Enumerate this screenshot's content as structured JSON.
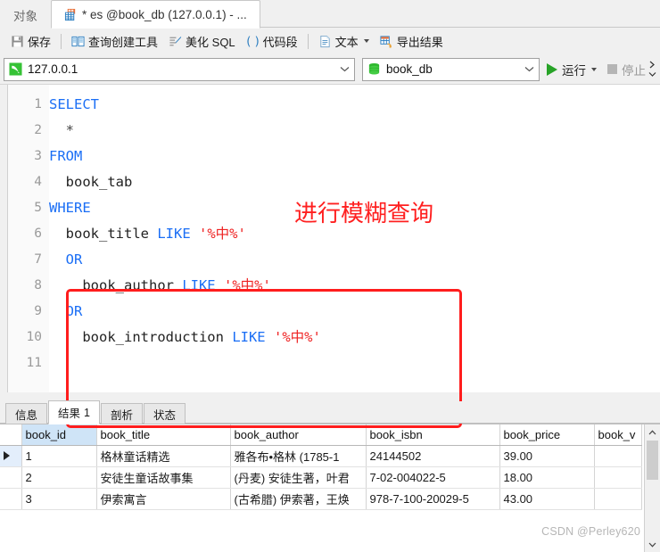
{
  "window": {
    "tabs": [
      {
        "label": "对象",
        "icon": "none",
        "active": false
      },
      {
        "label": "* es @book_db (127.0.0.1) - ...",
        "icon": "table-icon",
        "active": true
      }
    ]
  },
  "toolbar": {
    "items": [
      {
        "label": "保存",
        "icon": "save-icon"
      },
      {
        "label": "查询创建工具",
        "icon": "query-builder-icon"
      },
      {
        "label": "美化 SQL",
        "icon": "beautify-sql-icon"
      },
      {
        "label": "代码段",
        "icon": "code-snippet-icon"
      },
      {
        "label": "文本",
        "icon": "text-icon",
        "has_caret": true
      },
      {
        "label": "导出结果",
        "icon": "export-result-icon"
      }
    ]
  },
  "connection_bar": {
    "connection": {
      "value": "127.0.0.1",
      "icon": "connection-icon"
    },
    "database": {
      "value": "book_db",
      "icon": "database-icon"
    },
    "run": {
      "label": "运行",
      "icon": "play-icon",
      "has_caret": true
    },
    "stop": {
      "label": "停止",
      "icon": "stop-icon",
      "enabled": false
    },
    "overflow": {
      "icon": "chevron-overflow-icon"
    }
  },
  "editor": {
    "line_numbers": [
      "1",
      "2",
      "3",
      "4",
      "5",
      "6",
      "7",
      "8",
      "9",
      "10",
      "11"
    ],
    "lines": [
      {
        "indent": 0,
        "parts": [
          {
            "t": "SELECT",
            "c": "kw"
          }
        ]
      },
      {
        "indent": 1,
        "parts": [
          {
            "t": "*",
            "c": "op"
          }
        ]
      },
      {
        "indent": 0,
        "parts": [
          {
            "t": "FROM",
            "c": "kw"
          }
        ]
      },
      {
        "indent": 1,
        "parts": [
          {
            "t": "book_tab",
            "c": "id"
          }
        ]
      },
      {
        "indent": 0,
        "parts": [
          {
            "t": "WHERE",
            "c": "kw"
          }
        ]
      },
      {
        "indent": 1,
        "parts": [
          {
            "t": "book_title ",
            "c": "id"
          },
          {
            "t": "LIKE ",
            "c": "kw"
          },
          {
            "t": "'%中%'",
            "c": "str"
          }
        ]
      },
      {
        "indent": 1,
        "parts": [
          {
            "t": "OR",
            "c": "kw"
          }
        ]
      },
      {
        "indent": 2,
        "parts": [
          {
            "t": "book_author ",
            "c": "id"
          },
          {
            "t": "LIKE ",
            "c": "kw"
          },
          {
            "t": "'%中%'",
            "c": "str"
          }
        ]
      },
      {
        "indent": 1,
        "parts": [
          {
            "t": "OR",
            "c": "kw"
          }
        ]
      },
      {
        "indent": 2,
        "parts": [
          {
            "t": "book_introduction ",
            "c": "id"
          },
          {
            "t": "LIKE ",
            "c": "kw"
          },
          {
            "t": "'%中%'",
            "c": "str"
          }
        ]
      },
      {
        "indent": 0,
        "parts": []
      }
    ],
    "annotation": "进行模糊查询",
    "annotation_color": "#ff2020",
    "highlight_box_color": "#ff1d1d"
  },
  "result_tabs": [
    {
      "label": "信息",
      "count": "",
      "active": false
    },
    {
      "label": "结果",
      "count": "1",
      "active": true
    },
    {
      "label": "剖析",
      "count": "",
      "active": false
    },
    {
      "label": "状态",
      "count": "",
      "active": false
    }
  ],
  "result_grid": {
    "columns": [
      "book_id",
      "book_title",
      "book_author",
      "book_isbn",
      "book_price",
      "book_v"
    ],
    "selected_column": "book_id",
    "rows": [
      {
        "current": true,
        "book_id": "1",
        "book_title": "格林童话精选",
        "book_author": "雅各布•格林 (1785-1",
        "book_isbn": "24144502",
        "book_price": "39.00",
        "book_v": ""
      },
      {
        "current": false,
        "book_id": "2",
        "book_title": "安徒生童话故事集",
        "book_author": "(丹麦) 安徒生著，叶君",
        "book_isbn": "7-02-004022-5",
        "book_price": "18.00",
        "book_v": ""
      },
      {
        "current": false,
        "book_id": "3",
        "book_title": "伊索寓言",
        "book_author": "(古希腊) 伊索著，王焕",
        "book_isbn": "978-7-100-20029-5",
        "book_price": "43.00",
        "book_v": ""
      }
    ]
  },
  "watermark": "CSDN @Perley620"
}
